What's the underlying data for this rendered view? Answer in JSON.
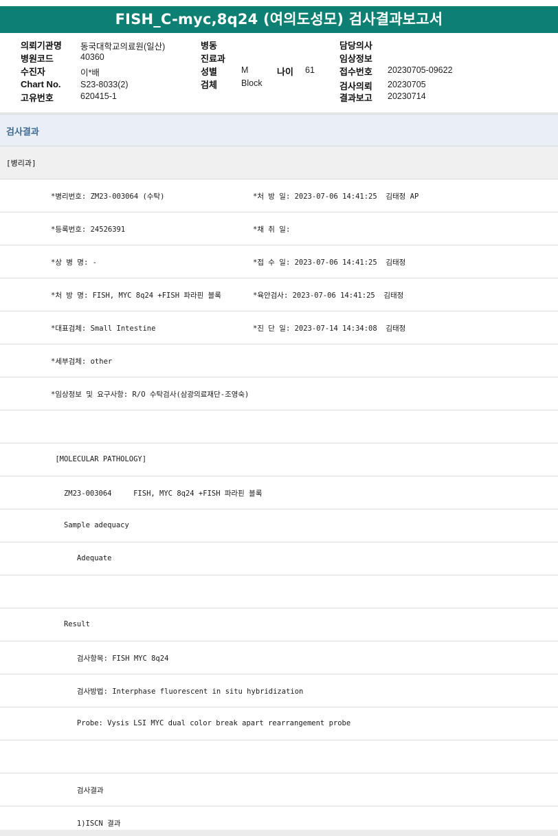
{
  "title": "FISH_C-myc,8q24 (여의도성모) 검사결과보고서",
  "info": {
    "hospital_label": "의뢰기관명",
    "hospital": "동국대학교의료원(일산)",
    "code_label": "병원코드",
    "code": "40360",
    "patient_label": "수진자",
    "patient": "이*배",
    "chart_label": "Chart No.",
    "chart": "S23-8033(2)",
    "unique_label": "고유번호",
    "unique": "620415-1",
    "ward_label": "병동",
    "dept_label": "진료과",
    "sex_label": "성별",
    "sex": "M",
    "age_label": "나이",
    "age": "61",
    "specimen_label": "검체",
    "specimen": "Block",
    "doctor_label": "담당의사",
    "clinical_label": "임상정보",
    "receipt_label": "접수번호",
    "receipt": "20230705-09622",
    "request_label": "검사의뢰",
    "request": "20230705",
    "report_label": "결과보고",
    "report": "20230714"
  },
  "section_title": "검사결과",
  "department": "[병리과]",
  "rows": [
    {
      "left": "*병리번호: ZM23-003064 (수탁)",
      "right": "*처 방 일: 2023-07-06 14:41:25  김태정 AP"
    },
    {
      "left": "*등록번호: 24526391",
      "right": "*채 취 일:"
    },
    {
      "left": "*상 병 명: -",
      "right": "*접 수 일: 2023-07-06 14:41:25  김태정"
    },
    {
      "left": "*처 방 명: FISH, MYC 8q24 +FISH 파라핀 블록",
      "right": "*육안검사: 2023-07-06 14:41:25  김태정"
    },
    {
      "left": "*대표검체: Small Intestine",
      "right": "*진 단 일: 2023-07-14 14:34:08  김태정"
    },
    {
      "left": "*세부검체: other",
      "right": ""
    },
    {
      "left": "*임상정보 및 요구사항: R/O 수탁검사(삼광의료재단-조영숙)",
      "right": ""
    },
    {
      "left": "",
      "right": ""
    },
    {
      "left": " [MOLECULAR PATHOLOGY]",
      "right": ""
    },
    {
      "left": "   ZM23-003064     FISH, MYC 8q24 +FISH 파라핀 블록",
      "right": ""
    },
    {
      "left": "   Sample adequacy",
      "right": ""
    },
    {
      "left": "      Adequate",
      "right": ""
    },
    {
      "left": "",
      "right": ""
    },
    {
      "left": "   Result",
      "right": ""
    },
    {
      "left": "      검사항목: FISH MYC 8q24",
      "right": ""
    },
    {
      "left": "      검사방법: Interphase fluorescent in situ hybridization",
      "right": ""
    },
    {
      "left": "      Probe: Vysis LSI MYC dual color break apart rearrangement probe",
      "right": ""
    },
    {
      "left": "",
      "right": ""
    },
    {
      "left": "      검사결과",
      "right": ""
    },
    {
      "left": "      1)ISCN 결과",
      "right": ""
    }
  ]
}
